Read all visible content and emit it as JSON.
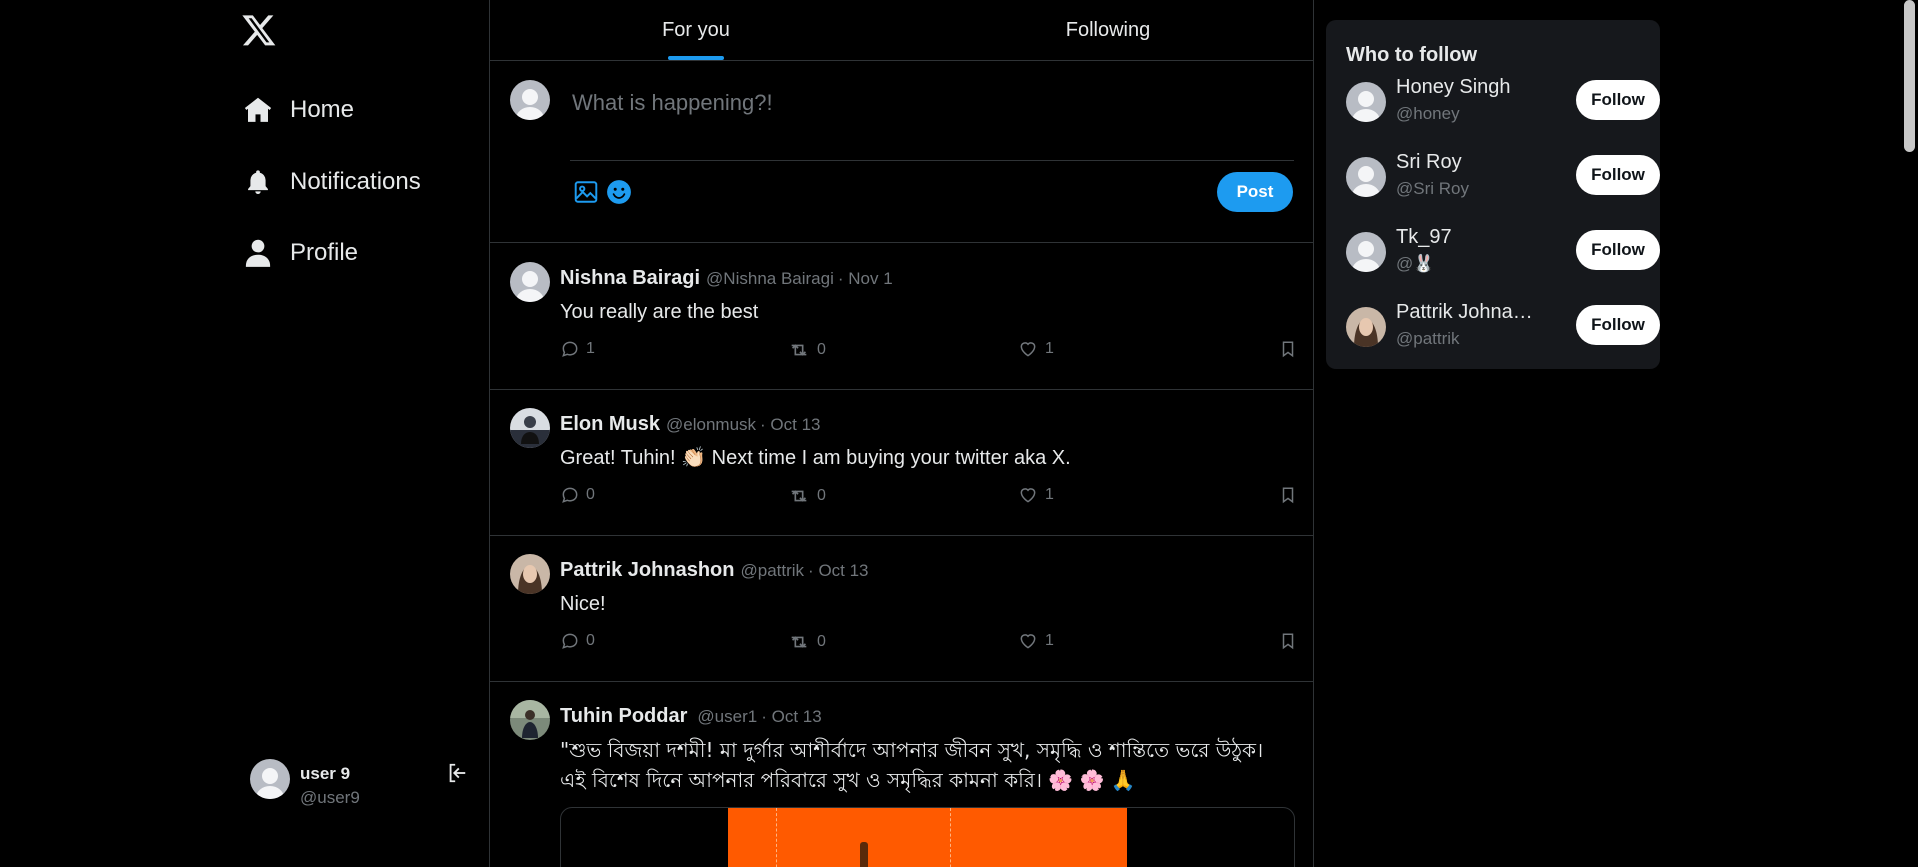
{
  "app": {
    "logo": "X"
  },
  "nav": [
    {
      "label": "Home",
      "icon": "home-icon"
    },
    {
      "label": "Notifications",
      "icon": "bell-icon"
    },
    {
      "label": "Profile",
      "icon": "person-icon"
    }
  ],
  "current_user": {
    "name": "user 9",
    "handle": "@user9"
  },
  "tabs": [
    {
      "label": "For you",
      "active": true
    },
    {
      "label": "Following",
      "active": false
    }
  ],
  "composer": {
    "placeholder": "What is happening?!",
    "post_label": "Post"
  },
  "tweets": [
    {
      "name": "Nishna Bairagi",
      "handle": "@Nishna Bairagi",
      "date": "Nov 1",
      "text": "You really are the best",
      "replies": "1",
      "retweets": "0",
      "likes": "1"
    },
    {
      "name": "Elon Musk",
      "handle": "@elonmusk",
      "date": "Oct 13",
      "text": "Great! Tuhin! 👏🏻 Next time I am buying your twitter aka X.",
      "replies": "0",
      "retweets": "0",
      "likes": "1"
    },
    {
      "name": "Pattrik Johnashon",
      "handle": "@pattrik",
      "date": "Oct 13",
      "text": "Nice!",
      "replies": "0",
      "retweets": "0",
      "likes": "1"
    },
    {
      "name": "Tuhin Poddar",
      "handle": "@user1",
      "date": "Oct 13",
      "text": "\"শুভ বিজয়া দশমী! মা দুর্গার আশীর্বাদে আপনার জীবন সুখ, সমৃদ্ধি ও শান্তিতে ভরে উঠুক। এই বিশেষ দিনে আপনার পরিবারে সুখ ও সমৃদ্ধির কামনা করি। 🌸 🌸 🙏"
    }
  ],
  "who_to_follow": {
    "title": "Who to follow",
    "users": [
      {
        "name": "Honey Singh",
        "handle": "@honey",
        "button": "Follow"
      },
      {
        "name": "Sri Roy",
        "handle": "@Sri Roy",
        "button": "Follow"
      },
      {
        "name": "Tk_97",
        "handle": "@🐰",
        "button": "Follow"
      },
      {
        "name": "Pattrik Johnas...",
        "handle": "@pattrik",
        "button": "Follow"
      }
    ]
  },
  "colors": {
    "accent": "#1d9bf0",
    "background": "#000000",
    "muted": "#71767b",
    "border": "#2f3336",
    "panel": "#16181c",
    "media_orange": "#ff5a00"
  }
}
